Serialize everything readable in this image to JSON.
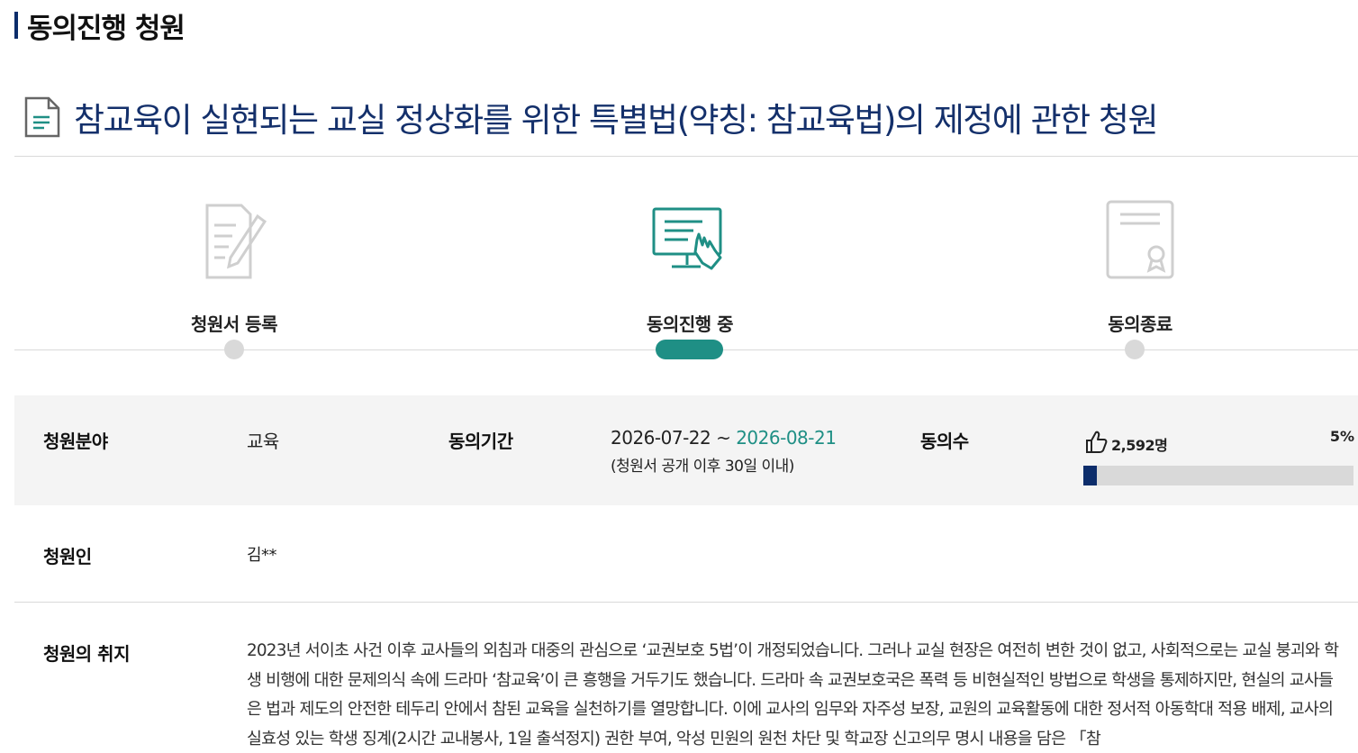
{
  "section": {
    "title": "동의진행 청원"
  },
  "petition": {
    "title": "참교육이 실현되는 교실 정상화를 위한 특별법(약칭: 참교육법)의 제정에 관한 청원"
  },
  "steps": [
    {
      "label": "청원서 등록",
      "icon": "document-edit-icon"
    },
    {
      "label": "동의진행 중",
      "icon": "monitor-click-icon",
      "active": true
    },
    {
      "label": "동의종료",
      "icon": "certificate-icon"
    }
  ],
  "info": {
    "field_label": "청원분야",
    "field_value": "교육",
    "period_label": "동의기간",
    "period_start": "2026-07-22 ~ ",
    "period_end": "2026-08-21",
    "period_note": "(청원서 공개 이후 30일 이내)",
    "count_label": "동의수",
    "count_value": "2,592명",
    "percent_text": "5%",
    "progress_fraction": 0.05,
    "petitioner_label": "청원인",
    "petitioner_value": "김**"
  },
  "purpose": {
    "label": "청원의 취지",
    "text": "2023년 서이초 사건 이후 교사들의 외침과 대중의 관심으로 ‘교권보호 5법’이 개정되었습니다. 그러나 교실 현장은 여전히 변한 것이 없고, 사회적으로는 교실 붕괴와 학생 비행에 대한 문제의식 속에 드라마 ‘참교육’이 큰 흥행을 거두기도 했습니다. 드라마 속 교권보호국은 폭력 등 비현실적인 방법으로 학생을 통제하지만, 현실의 교사들은 법과 제도의 안전한 테두리 안에서 참된 교육을 실천하기를 열망합니다. 이에 교사의 임무와 자주성 보장, 교원의 교육활동에 대한 정서적 아동학대 적용 배제, 교사의 실효성 있는 학생 징계(2시간 교내봉사, 1일 출석정지) 권한 부여, 악성 민원의 원천 차단 및 학교장 신고의무 명시 내용을 담은 「참"
  },
  "colors": {
    "navy": "#0c2d6b",
    "teal": "#1f8f85",
    "title": "#14306b",
    "gray": "#d9d9d9",
    "band": "#f4f4f4"
  }
}
